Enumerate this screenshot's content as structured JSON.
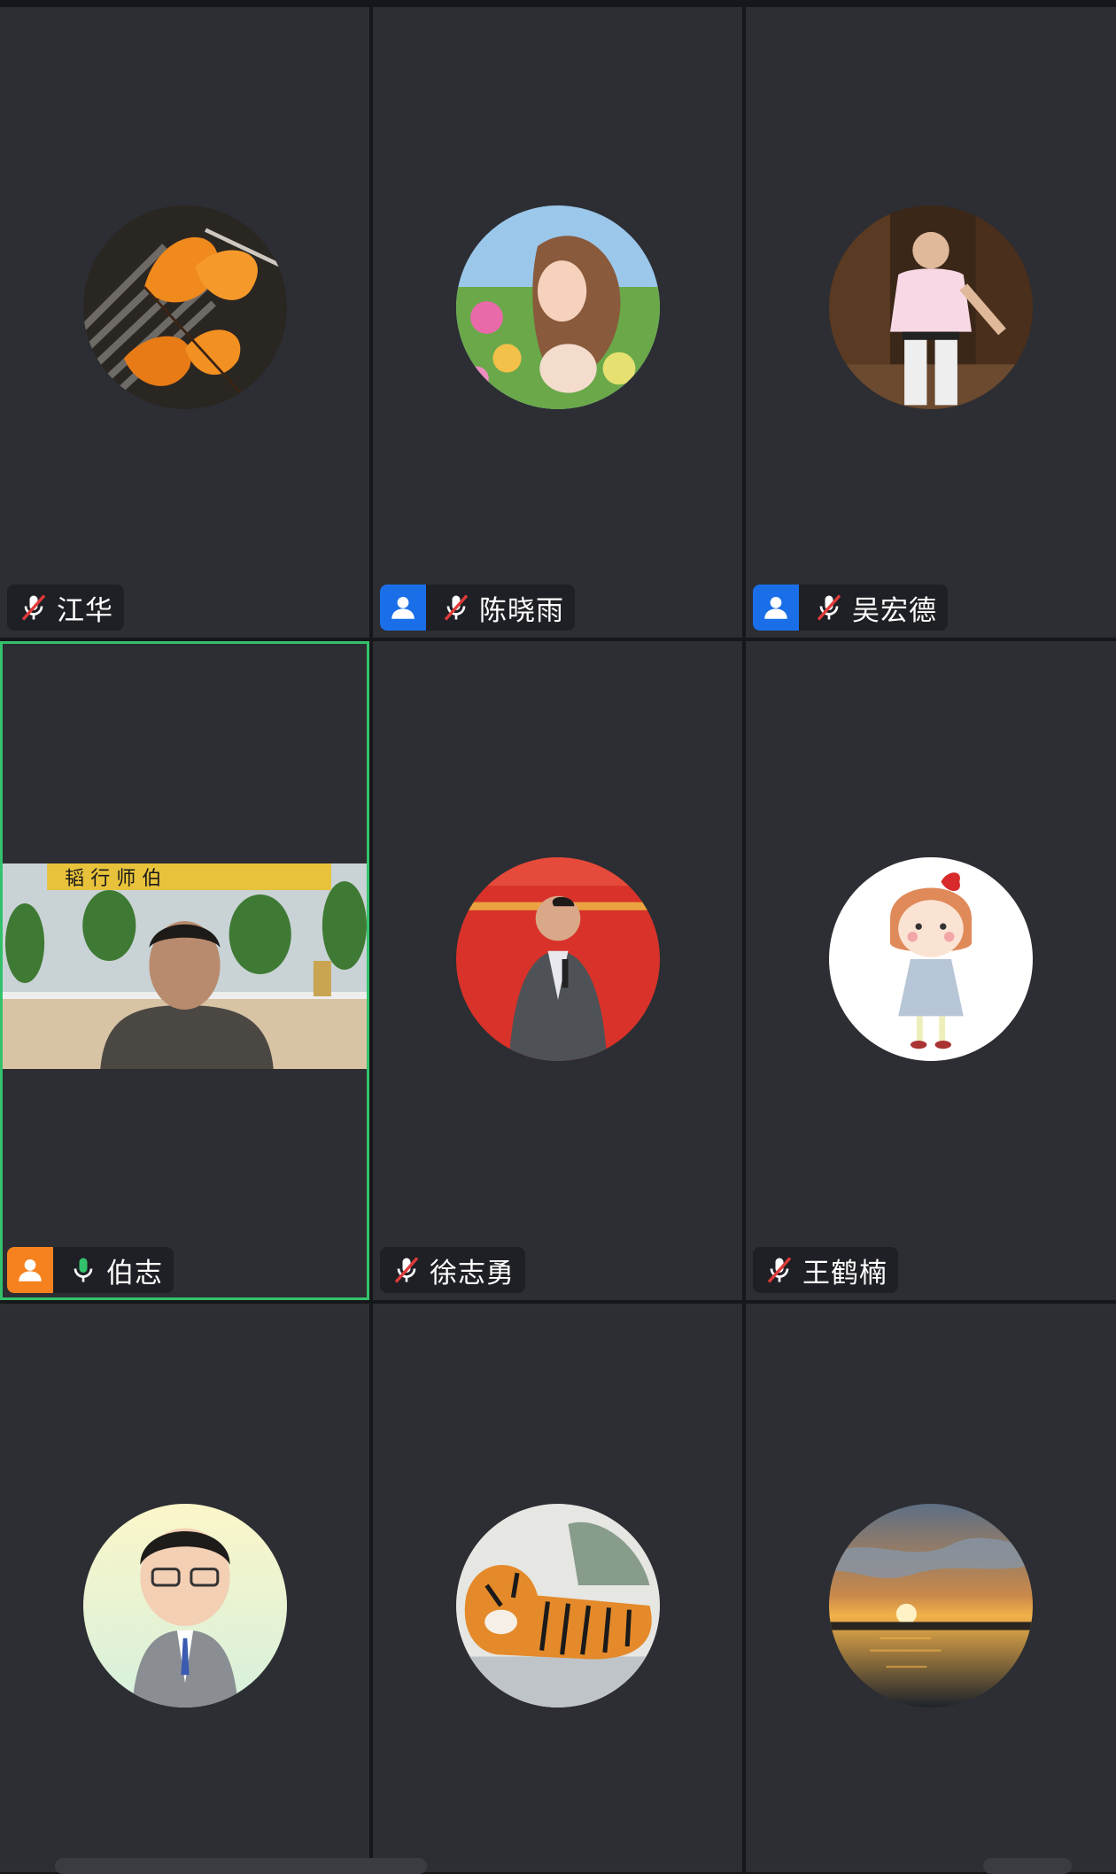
{
  "participants": [
    {
      "name": "江华",
      "role": "none",
      "mic": "muted",
      "avatar": "orange-leaves",
      "video": false
    },
    {
      "name": "陈晓雨",
      "role": "host",
      "mic": "muted",
      "avatar": "girl-flowers",
      "video": false
    },
    {
      "name": "吴宏德",
      "role": "host",
      "mic": "muted",
      "avatar": "man-pink-shirt",
      "video": false
    },
    {
      "name": "伯志",
      "role": "cohost",
      "mic": "active",
      "avatar": "",
      "video": true
    },
    {
      "name": "徐志勇",
      "role": "none",
      "mic": "muted",
      "avatar": "speaker-red-banner",
      "video": false
    },
    {
      "name": "王鹤楠",
      "role": "none",
      "mic": "muted",
      "avatar": "cartoon-girl",
      "video": false
    },
    {
      "name": "",
      "role": "none",
      "mic": "",
      "avatar": "cartoon-man-suit",
      "video": false
    },
    {
      "name": "",
      "role": "none",
      "mic": "",
      "avatar": "tiger-painting",
      "video": false
    },
    {
      "name": "",
      "role": "none",
      "mic": "",
      "avatar": "sunset-sea",
      "video": false
    }
  ],
  "colors": {
    "tile_bg": "#2c2e33",
    "active_border": "#33c26b",
    "host_badge": "#1a6fe8",
    "cohost_badge": "#f5821f",
    "mic_muted": "#e03a3a",
    "mic_active": "#33c26b"
  },
  "icons": {
    "muted_mic": "mic-muted-icon",
    "active_mic": "mic-icon",
    "host": "user-icon"
  }
}
